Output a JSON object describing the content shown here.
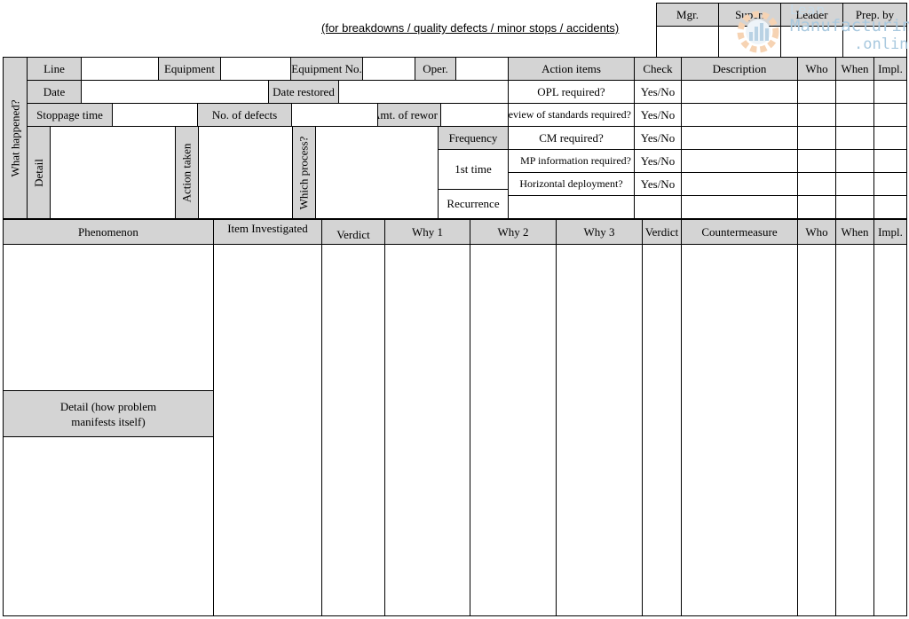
{
  "subtitle": "(for breakdowns / quality defects / minor stops / accidents)",
  "watermark": {
    "line1": "Lean",
    "line2": "Manufacturing",
    "line3": ".online"
  },
  "signoff": {
    "mgr": "Mgr.",
    "super": "Super.",
    "leader": "Leader",
    "prep_by": "Prep. by"
  },
  "what_happened": {
    "section_label": "What happened?",
    "line": "Line",
    "equipment": "Equipment",
    "equipment_no": "Equipment No.",
    "oper": "Oper.",
    "date": "Date",
    "date_restored": "Date  restored",
    "stoppage_time": "Stoppage time",
    "no_of_defects": "No. of defects",
    "amt_of_rework": "Amt. of rewor",
    "detail": "Detail",
    "action_taken": "Action taken",
    "which_process": "Which process?",
    "frequency": "Frequency",
    "first_time": "1st time",
    "recurrence": "Recurrence"
  },
  "action_items": {
    "headers": {
      "action_items": "Action items",
      "check": "Check",
      "description": "Description",
      "who": "Who",
      "when": "When",
      "impl": "Impl."
    },
    "rows": [
      {
        "item": "OPL required?",
        "check": "Yes/No"
      },
      {
        "item": "Review of standards required?",
        "check": "Yes/No"
      },
      {
        "item": "CM required?",
        "check": "Yes/No"
      },
      {
        "item": "MP information required?",
        "check": "Yes/No"
      },
      {
        "item": "Horizontal deployment?",
        "check": "Yes/No"
      }
    ]
  },
  "analysis": {
    "headers": {
      "phenomenon": "Phenomenon",
      "item_investigated": "Item Investigated",
      "verdict": "Verdict",
      "why1": "Why 1",
      "why2": "Why 2",
      "why3": "Why 3",
      "verdict2": "Verdict",
      "countermeasure": "Countermeasure",
      "who": "Who",
      "when": "When",
      "impl": "Impl."
    },
    "detail_label": "Detail (how problem manifests itself)"
  }
}
